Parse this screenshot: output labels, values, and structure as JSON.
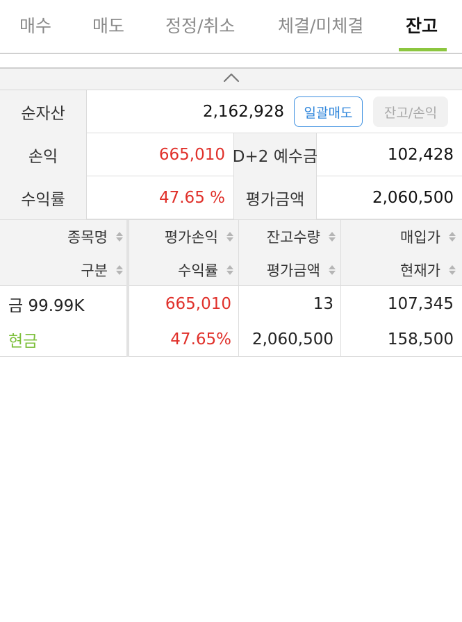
{
  "tabs": [
    {
      "label": "매수"
    },
    {
      "label": "매도"
    },
    {
      "label": "정정/취소"
    },
    {
      "label": "체결/미체결"
    },
    {
      "label": "잔고"
    }
  ],
  "active_tab": "잔고",
  "accent_color": "#8cc63f",
  "collapse_icon": "chevron-up-icon",
  "summary": {
    "net_assets_label": "순자산",
    "net_assets_value": "2,162,928",
    "bulk_sell_label": "일괄매도",
    "balance_pl_label": "잔고/손익",
    "pl_label": "손익",
    "pl_value": "665,010",
    "deposit_label": "D+2 예수금",
    "deposit_value": "102,428",
    "return_label": "수익률",
    "return_value": "47.65 %",
    "eval_label": "평가금액",
    "eval_value": "2,060,500"
  },
  "table": {
    "headers": {
      "name": "종목명",
      "type": "구분",
      "eval_pl": "평가손익",
      "return": "수익률",
      "qty": "잔고수량",
      "eval_amt": "평가금액",
      "buy_price": "매입가",
      "cur_price": "현재가"
    },
    "rows": [
      {
        "name": "금 99.99K",
        "type": "현금",
        "eval_pl": "665,010",
        "return": "47.65%",
        "qty": "13",
        "eval_amt": "2,060,500",
        "buy_price": "107,345",
        "cur_price": "158,500"
      }
    ]
  }
}
